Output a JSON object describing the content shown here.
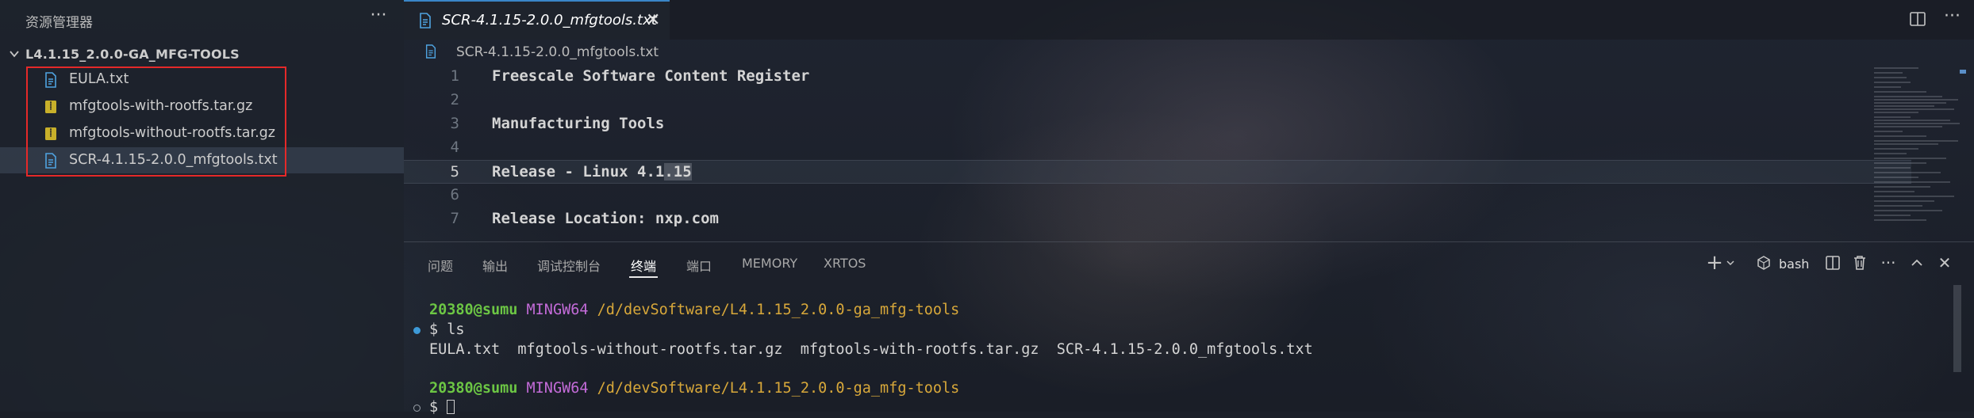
{
  "explorer": {
    "title": "资源管理器",
    "more_icon": "ellipsis-icon",
    "folder": "L4.1.15_2.0.0-GA_MFG-TOOLS",
    "files": [
      {
        "name": "EULA.txt",
        "icon": "txt-file-icon"
      },
      {
        "name": "mfgtools-with-rootfs.tar.gz",
        "icon": "archive-file-icon"
      },
      {
        "name": "mfgtools-without-rootfs.tar.gz",
        "icon": "archive-file-icon"
      },
      {
        "name": "SCR-4.1.15-2.0.0_mfgtools.txt",
        "icon": "txt-file-icon"
      }
    ]
  },
  "editor": {
    "tab_label": "SCR-4.1.15-2.0.0_mfgtools.txt",
    "breadcrumb": "SCR-4.1.15-2.0.0_mfgtools.txt",
    "current_line": 5,
    "lines": [
      {
        "n": "1",
        "text": "Freescale Software Content Register"
      },
      {
        "n": "2",
        "text": ""
      },
      {
        "n": "3",
        "text": "Manufacturing Tools"
      },
      {
        "n": "4",
        "text": ""
      },
      {
        "n": "5",
        "text_before": "Release - Linux 4.1",
        "text_sel": ".15"
      },
      {
        "n": "6",
        "text": ""
      },
      {
        "n": "7",
        "text": "Release Location: nxp.com"
      }
    ]
  },
  "panel": {
    "tabs": [
      "问题",
      "输出",
      "调试控制台",
      "终端",
      "端口",
      "MEMORY",
      "XRTOS"
    ],
    "active_tab": "终端",
    "shell_label": "bash",
    "terminal": {
      "prompt_user": "20380@sumu",
      "prompt_host": "MINGW64",
      "prompt_path": "/d/devSoftware/L4.1.15_2.0.0-ga_mfg-tools",
      "command": "$ ls",
      "output": "EULA.txt  mfgtools-without-rootfs.tar.gz  mfgtools-with-rootfs.tar.gz  SCR-4.1.15-2.0.0_mfgtools.txt",
      "prompt2_user": "20380@sumu",
      "prompt2_host": "MINGW64",
      "prompt2_path": "/d/devSoftware/L4.1.15_2.0.0-ga_mfg-tools",
      "prompt2_symbol": "$"
    }
  },
  "colors": {
    "accent": "#3a86c8",
    "highlight_box": "#e52929",
    "term_user": "#6cc644",
    "term_host": "#c36bd8",
    "term_path": "#d8a83a"
  }
}
